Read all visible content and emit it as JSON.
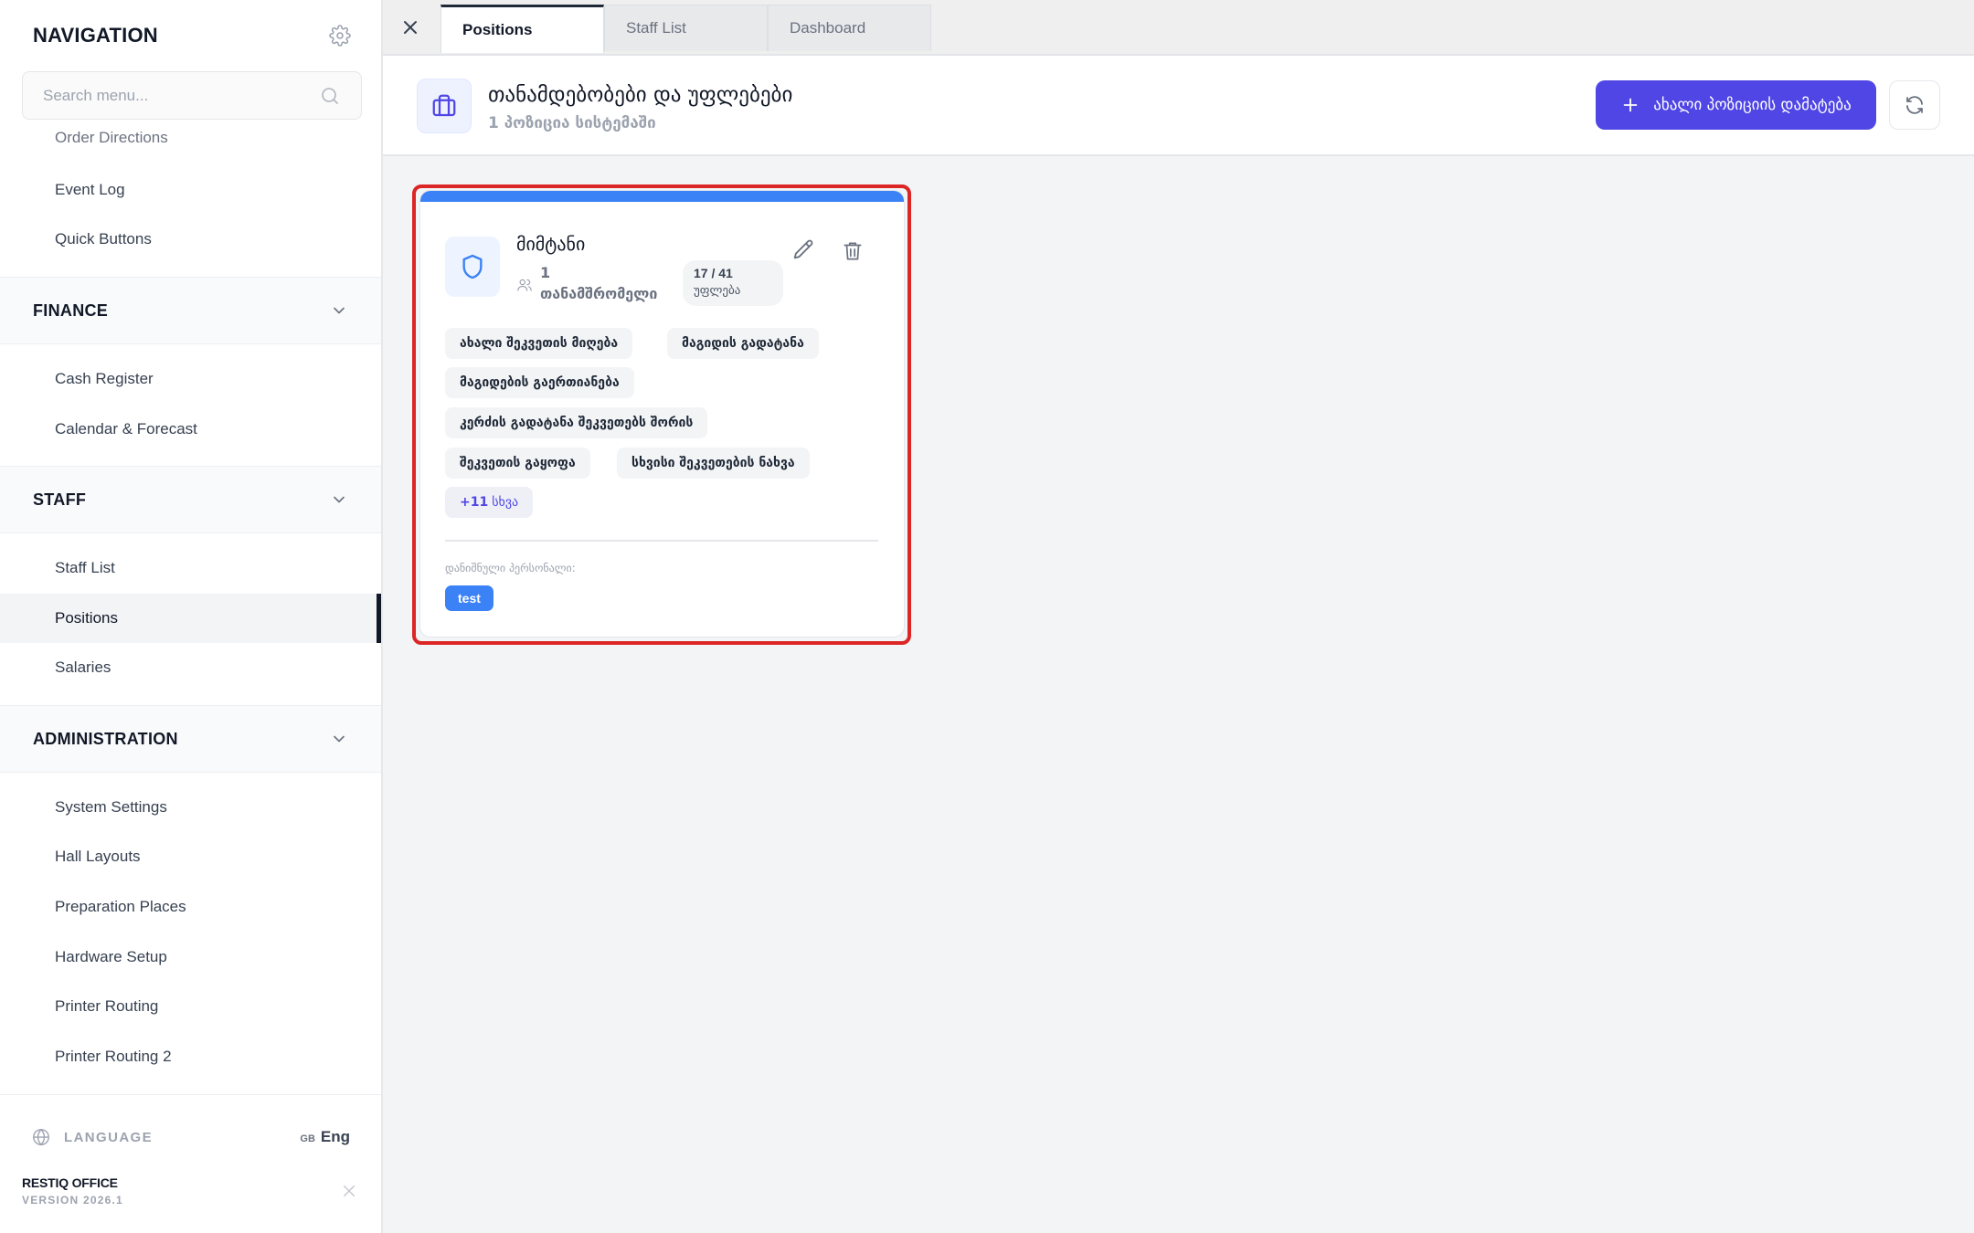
{
  "sidebar": {
    "title": "NAVIGATION",
    "settings_icon": "gear-icon",
    "search_placeholder": "Search menu...",
    "clipped_item": "Order Directions",
    "items_top": [
      {
        "label": "Event Log"
      },
      {
        "label": "Quick Buttons"
      }
    ],
    "sections": [
      {
        "label": "FINANCE",
        "items": [
          "Cash Register",
          "Calendar & Forecast"
        ]
      },
      {
        "label": "STAFF",
        "items": [
          "Staff List",
          "Positions",
          "Salaries"
        ],
        "active": "Positions"
      },
      {
        "label": "ADMINISTRATION",
        "items": [
          "System Settings",
          "Hall Layouts",
          "Preparation Places",
          "Hardware Setup",
          "Printer Routing",
          "Printer Routing 2"
        ]
      }
    ],
    "footer": {
      "language_label": "LANGUAGE",
      "language_flag": "GB",
      "language_value": "Eng",
      "brand": "RESTIQ OFFICE",
      "version": "VERSION 2026.1"
    }
  },
  "tabs": [
    {
      "label": "Positions",
      "active": true
    },
    {
      "label": "Staff List",
      "active": false
    },
    {
      "label": "Dashboard",
      "active": false
    }
  ],
  "header": {
    "title": "თანამდებობები და უფლებები",
    "subtitle": "1 პოზიცია სისტემაში",
    "add_button": "ახალი პოზიციის დამატება",
    "icon": "briefcase-icon"
  },
  "card": {
    "accent_color": "#3b82f6",
    "name": "მიმტანი",
    "employee_count": "1",
    "employee_label": "თანამშრომელი",
    "permissions_count": "17 / 41",
    "permissions_label": "უფლება",
    "tags": [
      "ახალი შეკვეთის მიღება",
      "მაგიდის გადატანა",
      "მაგიდების გაერთიანება",
      "კერძის გადატანა შეკვეთებს შორის",
      "შეკვეთის გაყოფა",
      "სხვისი შეკვეთების ნახვა"
    ],
    "more_count": "+11",
    "more_label": "სხვა",
    "assigned_label": "დანიშნული პერსონალი:",
    "assigned_staff": [
      "test"
    ]
  },
  "colors": {
    "primary": "#4f46e5",
    "accent": "#3b82f6",
    "highlight": "#dc2626"
  }
}
